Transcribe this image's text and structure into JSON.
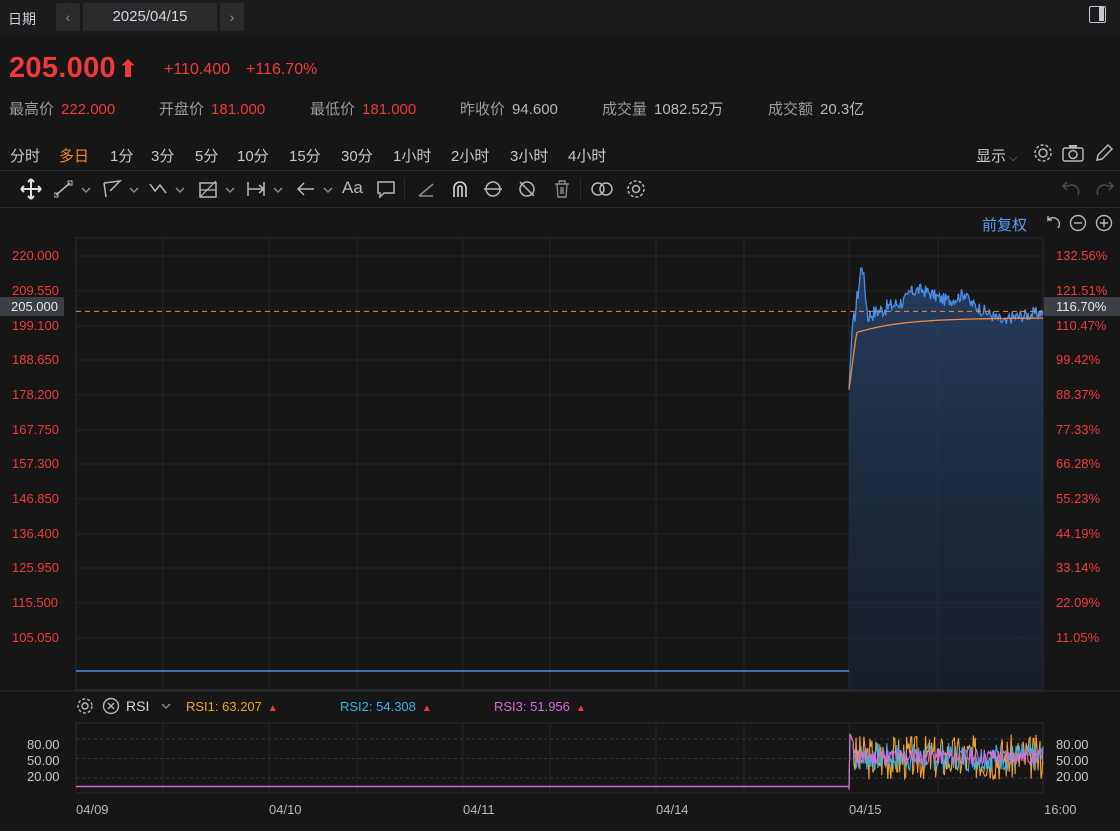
{
  "header": {
    "date_label": "日期",
    "date_value": "2025/04/15",
    "prev": "‹",
    "next": "›"
  },
  "quote": {
    "price": "205.000",
    "arrow": "🡅",
    "change": "+110.400",
    "change_pct": "+116.70%",
    "stats": [
      {
        "label": "最高价",
        "value": "222.000",
        "color": "red"
      },
      {
        "label": "开盘价",
        "value": "181.000",
        "color": "red"
      },
      {
        "label": "最低价",
        "value": "181.000",
        "color": "red"
      },
      {
        "label": "昨收价",
        "value": "94.600",
        "color": "grey"
      },
      {
        "label": "成交量",
        "value": "1082.52万",
        "color": "grey"
      },
      {
        "label": "成交额",
        "value": "20.3亿",
        "color": "grey"
      }
    ]
  },
  "periods": {
    "items": [
      "分时",
      "多日",
      "1分",
      "3分",
      "5分",
      "10分",
      "15分",
      "30分",
      "1小时",
      "2小时",
      "3小时",
      "4小时"
    ],
    "active": "多日",
    "display_label": "显示"
  },
  "chart": {
    "adjust_label": "前复权",
    "left_axis": [
      "220.000",
      "209.550",
      "199.100",
      "188.650",
      "178.200",
      "167.750",
      "157.300",
      "146.850",
      "136.400",
      "125.950",
      "115.500",
      "105.050"
    ],
    "right_axis": [
      "132.56%",
      "121.51%",
      "110.47%",
      "99.42%",
      "88.37%",
      "77.33%",
      "66.28%",
      "55.23%",
      "44.19%",
      "33.14%",
      "22.09%",
      "11.05%"
    ],
    "current_price_tag": "205.000",
    "current_pct_tag": "116.70%",
    "x_labels": [
      "04/09",
      "04/10",
      "04/11",
      "04/14",
      "04/15",
      "16:00"
    ]
  },
  "rsi": {
    "name": "RSI",
    "rsi1": "RSI1: 63.207",
    "rsi2": "RSI2: 54.308",
    "rsi3": "RSI3: 51.956",
    "axis": [
      "80.00",
      "50.00",
      "20.00"
    ]
  },
  "colors": {
    "up": "#f03a3a",
    "price_line": "#4a8fe7",
    "avg_line": "#f0883a",
    "rsi1": "#f0a030",
    "rsi2": "#35b3e8",
    "rsi3": "#d86bd8",
    "active": "#f0883a"
  },
  "chart_data": {
    "type": "line",
    "x": [
      "04/09",
      "04/10",
      "04/11",
      "04/14",
      "04/15"
    ],
    "series": [
      {
        "values": [
          94.6,
          94.6,
          94.6,
          94.6,
          205.0
        ]
      }
    ],
    "ylim": [
      94.6,
      222.0
    ]
  }
}
